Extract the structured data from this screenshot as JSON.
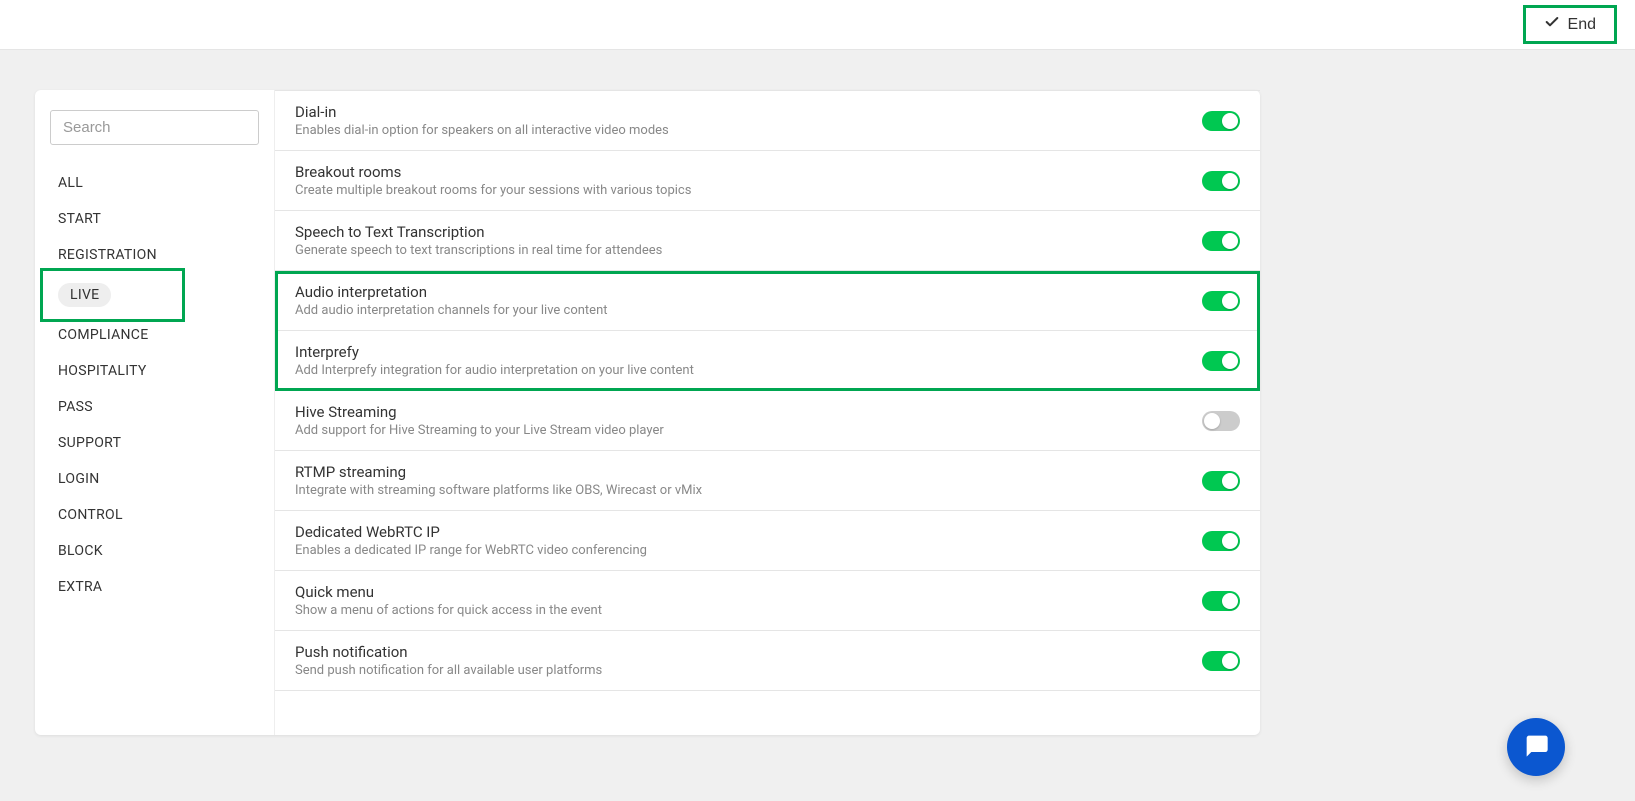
{
  "header": {
    "end_label": "End"
  },
  "sidebar": {
    "search_placeholder": "Search",
    "items": [
      {
        "label": "ALL",
        "active": false
      },
      {
        "label": "START",
        "active": false
      },
      {
        "label": "REGISTRATION",
        "active": false
      },
      {
        "label": "LIVE",
        "active": true
      },
      {
        "label": "COMPLIANCE",
        "active": false
      },
      {
        "label": "HOSPITALITY",
        "active": false
      },
      {
        "label": "PASS",
        "active": false
      },
      {
        "label": "SUPPORT",
        "active": false
      },
      {
        "label": "LOGIN",
        "active": false
      },
      {
        "label": "CONTROL",
        "active": false
      },
      {
        "label": "BLOCK",
        "active": false
      },
      {
        "label": "EXTRA",
        "active": false
      }
    ]
  },
  "settings": [
    {
      "title": "Dial-in",
      "desc": "Enables dial-in option for speakers on all interactive video modes",
      "on": true,
      "highlight": false
    },
    {
      "title": "Breakout rooms",
      "desc": "Create multiple breakout rooms for your sessions with various topics",
      "on": true,
      "highlight": false
    },
    {
      "title": "Speech to Text Transcription",
      "desc": "Generate speech to text transcriptions in real time for attendees",
      "on": true,
      "highlight": false
    },
    {
      "title": "Audio interpretation",
      "desc": "Add audio interpretation channels for your live content",
      "on": true,
      "highlight": true
    },
    {
      "title": "Interprefy",
      "desc": "Add Interprefy integration for audio interpretation on your live content",
      "on": true,
      "highlight": true
    },
    {
      "title": "Hive Streaming",
      "desc": "Add support for Hive Streaming to your Live Stream video player",
      "on": false,
      "highlight": false
    },
    {
      "title": "RTMP streaming",
      "desc": "Integrate with streaming software platforms like OBS, Wirecast or vMix",
      "on": true,
      "highlight": false
    },
    {
      "title": "Dedicated WebRTC IP",
      "desc": "Enables a dedicated IP range for WebRTC video conferencing",
      "on": true,
      "highlight": false
    },
    {
      "title": "Quick menu",
      "desc": "Show a menu of actions for quick access in the event",
      "on": true,
      "highlight": false
    },
    {
      "title": "Push notification",
      "desc": "Send push notification for all available user platforms",
      "on": true,
      "highlight": false
    }
  ],
  "colors": {
    "accent": "#00a651",
    "toggle_on": "#00c851",
    "chat": "#0b57d0"
  }
}
